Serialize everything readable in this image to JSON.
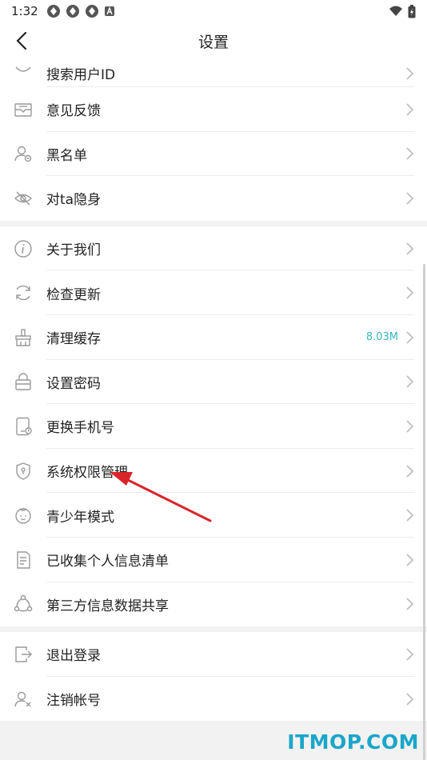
{
  "status_bar": {
    "time": "1:32"
  },
  "header": {
    "title": "设置"
  },
  "groups": [
    {
      "items": [
        {
          "label": "搜索用户ID",
          "icon": "search-user-icon"
        },
        {
          "label": "意见反馈",
          "icon": "feedback-mail-icon"
        },
        {
          "label": "黑名单",
          "icon": "blocked-user-icon"
        },
        {
          "label": "对ta隐身",
          "icon": "hidden-eye-icon"
        }
      ]
    },
    {
      "items": [
        {
          "label": "关于我们",
          "icon": "info-icon"
        },
        {
          "label": "检查更新",
          "icon": "refresh-icon"
        },
        {
          "label": "清理缓存",
          "icon": "broom-icon",
          "value": "8.03M"
        },
        {
          "label": "设置密码",
          "icon": "lock-icon"
        },
        {
          "label": "更换手机号",
          "icon": "phone-icon"
        },
        {
          "label": "系统权限管理",
          "icon": "shield-icon"
        },
        {
          "label": "青少年模式",
          "icon": "child-face-icon"
        },
        {
          "label": "已收集个人信息清单",
          "icon": "document-list-icon"
        },
        {
          "label": "第三方信息数据共享",
          "icon": "share-icon"
        }
      ]
    },
    {
      "items": [
        {
          "label": "退出登录",
          "icon": "logout-icon"
        },
        {
          "label": "注销帐号",
          "icon": "delete-user-icon"
        }
      ]
    }
  ],
  "watermark": "ITMOP.COM",
  "colors": {
    "accent_value": "#35b6c2",
    "annotation_arrow": "#d9252a",
    "watermark": "#1aa6c9"
  }
}
